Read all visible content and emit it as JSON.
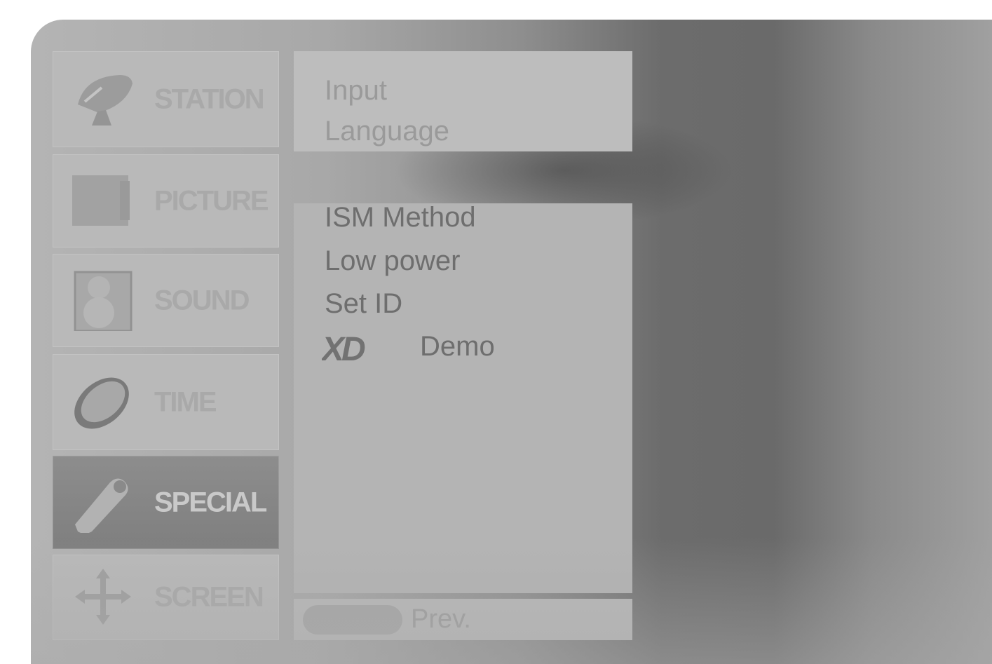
{
  "categories": [
    {
      "label": "STATION",
      "icon": "satellite-dish-icon",
      "active": false
    },
    {
      "label": "PICTURE",
      "icon": "picture-icon",
      "active": false
    },
    {
      "label": "SOUND",
      "icon": "speaker-icon",
      "active": false
    },
    {
      "label": "TIME",
      "icon": "clock-icon",
      "active": false
    },
    {
      "label": "SPECIAL",
      "icon": "tag-icon",
      "active": true
    },
    {
      "label": "SCREEN",
      "icon": "move-arrows-icon",
      "active": false
    }
  ],
  "menu_top": [
    "Input",
    "Language"
  ],
  "menu_main": [
    "ISM Method",
    "Low power",
    "Set ID"
  ],
  "xd_demo": {
    "logo": "XD",
    "label": "Demo"
  },
  "footer": {
    "prev_label": "Prev."
  },
  "colors": {
    "active_category": "#858585",
    "panel": "#b4b4b4"
  }
}
